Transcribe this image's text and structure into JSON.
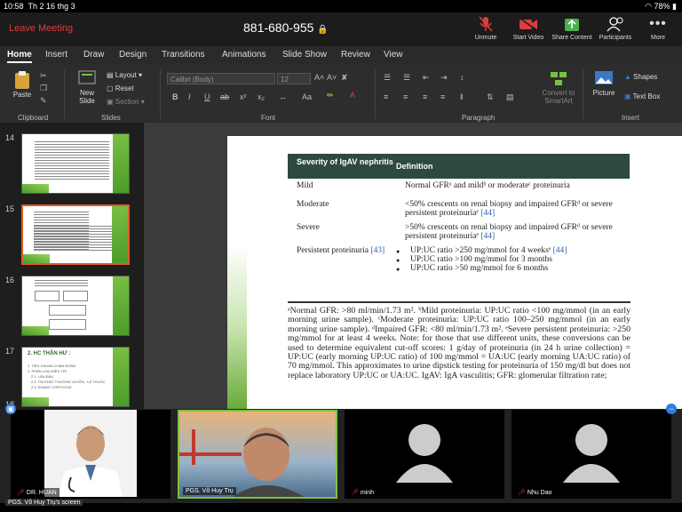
{
  "status_bar": {
    "time": "10:58",
    "date": "Th 2 16 thg 3",
    "battery": "78%"
  },
  "zoom": {
    "leave_label": "Leave Meeting",
    "meeting_id": "881-680-955",
    "buttons": [
      {
        "label": "Unmute",
        "icon": "mic-muted-icon",
        "color": "#e03c3c"
      },
      {
        "label": "Start Video",
        "icon": "video-off-icon",
        "color": "#e03c3c"
      },
      {
        "label": "Share Content",
        "icon": "share-icon",
        "color": "#4caf50"
      },
      {
        "label": "Participants",
        "icon": "participants-icon",
        "color": "#ffffff"
      },
      {
        "label": "More",
        "icon": "more-icon",
        "color": "#ffffff"
      }
    ]
  },
  "ribbon": {
    "tabs": [
      "Home",
      "Insert",
      "Draw",
      "Design",
      "Transitions",
      "Animations",
      "Slide Show",
      "Review",
      "View"
    ],
    "active_tab": "Home",
    "clipboard": {
      "paste": "Paste",
      "group": "Clipboard"
    },
    "slides": {
      "new_slide": "New Slide",
      "layout": "Layout",
      "reset": "Reset",
      "section": "Section",
      "group": "Slides"
    },
    "font": {
      "name": "Calibri (Body)",
      "size": "12",
      "group": "Font"
    },
    "paragraph": {
      "group": "Paragraph",
      "convert": "Convert to SmartArt"
    },
    "insert": {
      "picture": "Picture",
      "shapes": "Shapes",
      "text_box": "Text Box",
      "group": "Insert"
    }
  },
  "thumbnails": [
    {
      "number": "14"
    },
    {
      "number": "15"
    },
    {
      "number": "16"
    },
    {
      "number": "17",
      "title": "2. HC THẬN HƯ :",
      "lines": [
        "1. TIÊU CHUẨN CHẨN ĐOÁN",
        "2. PHÂN LOẠI ĐIỀU TRỊ",
        "2.1. LẦN ĐẦU",
        "2.2. TÁI PHÁT THƯỜNG XUYÊN - LỆ THUỘC",
        "2.3. KHÁNG CORTICOID"
      ]
    },
    {
      "number": "18"
    }
  ],
  "slide": {
    "header_col1": "Severity of IgAV nephritis",
    "header_col2": "Definition",
    "rows": [
      {
        "term": "Mild",
        "definition": "Normal GFRᵃ and mildᵇ or moderateᶜ proteinuria"
      },
      {
        "term": "Moderate",
        "definition": "<50% crescents on renal biopsy and impaired GFRᵈ or severe persistent proteinuriaᵉ",
        "ref": "[44]"
      },
      {
        "term": "Severe",
        "definition": ">50% crescents on renal biopsy and impaired GFRᵈ or severe persistent proteinuriaᵉ",
        "ref": "[44]"
      },
      {
        "term": "Persistent proteinuria",
        "term_ref": "[43]",
        "bullets": [
          {
            "text": "UP:UC ratio >250 mg/mmol for 4 weeksᵉ",
            "ref": "[44]"
          },
          {
            "text": "UP:UC ratio >100 mg/mmol for 3 months"
          },
          {
            "text": "UP:UC ratio >50 mg/mmol for 6 months"
          }
        ]
      }
    ],
    "note": "ᵃNormal GFR: >80 ml/min/1.73 m². ᵇMild proteinuria: UP:UC ratio <100 mg/mmol (in an early morning urine sample). ᶜModerate proteinuria: UP:UC ratio 100–250 mg/mmol (in an early morning urine sample). ᵈImpaired GFR: <80 ml/min/1.73 m². ᵉSevere persistent proteinuria: >250 mg/mmol for at least 4 weeks. Note: for those that use different units, these conversions can be used to determine equivalent cut-off scores: 1 g/day of proteinuria (in 24 h urine collection) = UP:UC (early morning UP:UC ratio) of 100 mg/mmol = UA:UC (early morning UA:UC ratio) of 70 mg/mmol. This approximates to urine dipstick testing for proteinuria of 150 mg/dl but does not replace laboratory UP:UC or UA:UC. IgAV: IgA vasculitis; GFR: glomerular filtration rate;"
  },
  "participants": [
    {
      "name": "DR. HUAN"
    },
    {
      "name": "PGS. Võ Huy Trụ",
      "active": true
    },
    {
      "name": "minh"
    },
    {
      "name": "Nhu Dao"
    }
  ],
  "screen_label": "PGS. Võ Huy Trụ's screen"
}
